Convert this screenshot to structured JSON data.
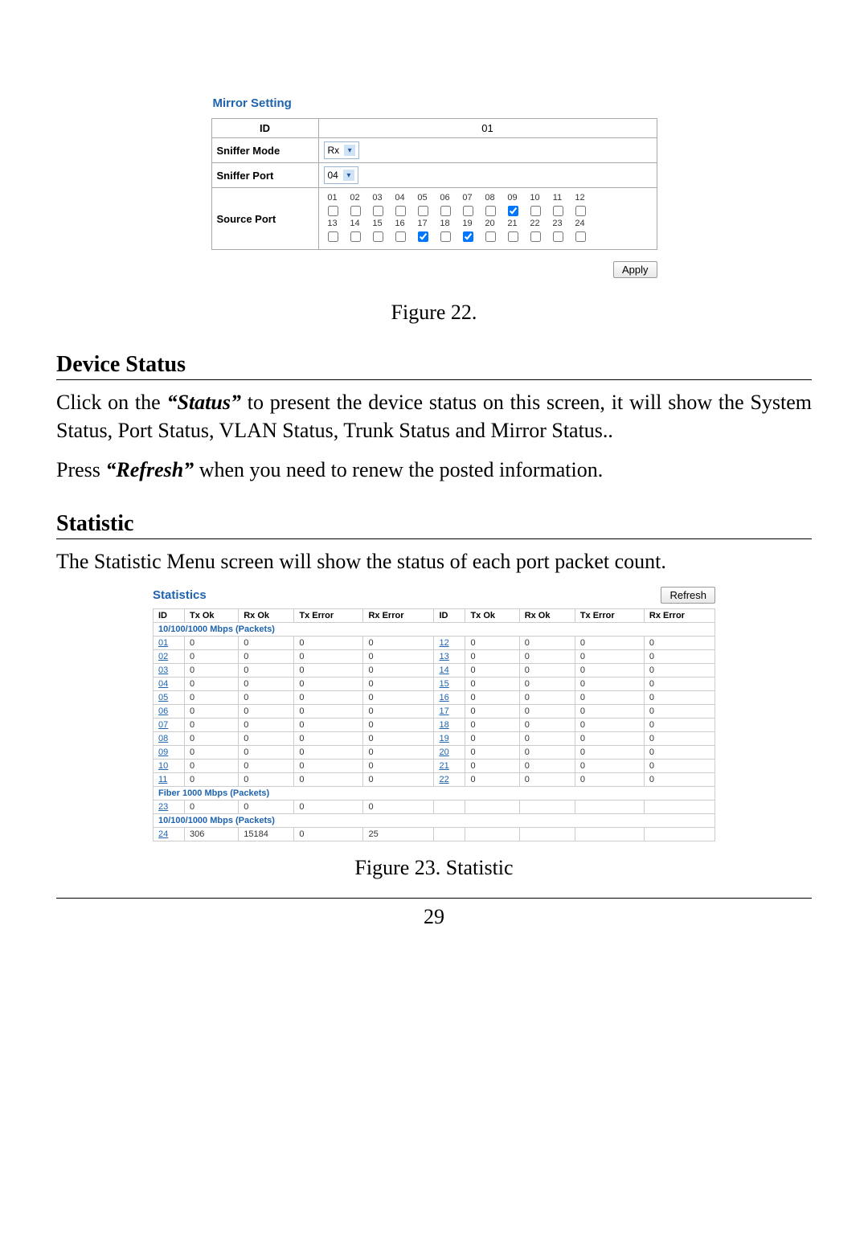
{
  "figure22": {
    "title": "Mirror Setting",
    "rows": {
      "id_label": "ID",
      "id_value": "01",
      "mode_label": "Sniffer Mode",
      "mode_value": "Rx",
      "port_label": "Sniffer Port",
      "port_value": "04",
      "source_label": "Source Port"
    },
    "port_numbers_top": [
      "01",
      "02",
      "03",
      "04",
      "05",
      "06",
      "07",
      "08",
      "09",
      "10",
      "11",
      "12"
    ],
    "port_numbers_bottom": [
      "13",
      "14",
      "15",
      "16",
      "17",
      "18",
      "19",
      "20",
      "21",
      "22",
      "23",
      "24"
    ],
    "checked_ports_top_idx": [
      8
    ],
    "checked_ports_bottom_idx": [
      4,
      6
    ],
    "apply_label": "Apply",
    "caption": "Figure 22."
  },
  "section1": {
    "heading": "Device Status",
    "p1a": "Click on the ",
    "p1_em": "“Status”",
    "p1b": " to present the device status on this screen, it will show the System Status, Port Status, VLAN Status, Trunk Status and Mirror Status..",
    "p2a": "Press ",
    "p2_em": "“Refresh”",
    "p2b": " when you need to renew the posted information."
  },
  "section2": {
    "heading": "Statistic",
    "p1": "The Statistic Menu screen will show the status of each port packet count."
  },
  "figure23": {
    "title": "Statistics",
    "refresh_label": "Refresh",
    "headers": [
      "ID",
      "Tx Ok",
      "Rx Ok",
      "Tx Error",
      "Rx Error",
      "ID",
      "Tx Ok",
      "Rx Ok",
      "Tx Error",
      "Rx Error"
    ],
    "section_a": "10/100/1000 Mbps (Packets)",
    "section_b": "Fiber 1000 Mbps (Packets)",
    "section_c": "10/100/1000 Mbps (Packets)",
    "left_rows": [
      {
        "id": "01",
        "tx": "0",
        "rx": "0",
        "txe": "0",
        "rxe": "0"
      },
      {
        "id": "02",
        "tx": "0",
        "rx": "0",
        "txe": "0",
        "rxe": "0"
      },
      {
        "id": "03",
        "tx": "0",
        "rx": "0",
        "txe": "0",
        "rxe": "0"
      },
      {
        "id": "04",
        "tx": "0",
        "rx": "0",
        "txe": "0",
        "rxe": "0"
      },
      {
        "id": "05",
        "tx": "0",
        "rx": "0",
        "txe": "0",
        "rxe": "0"
      },
      {
        "id": "06",
        "tx": "0",
        "rx": "0",
        "txe": "0",
        "rxe": "0"
      },
      {
        "id": "07",
        "tx": "0",
        "rx": "0",
        "txe": "0",
        "rxe": "0"
      },
      {
        "id": "08",
        "tx": "0",
        "rx": "0",
        "txe": "0",
        "rxe": "0"
      },
      {
        "id": "09",
        "tx": "0",
        "rx": "0",
        "txe": "0",
        "rxe": "0"
      },
      {
        "id": "10",
        "tx": "0",
        "rx": "0",
        "txe": "0",
        "rxe": "0"
      },
      {
        "id": "11",
        "tx": "0",
        "rx": "0",
        "txe": "0",
        "rxe": "0"
      }
    ],
    "right_rows": [
      {
        "id": "12",
        "tx": "0",
        "rx": "0",
        "txe": "0",
        "rxe": "0"
      },
      {
        "id": "13",
        "tx": "0",
        "rx": "0",
        "txe": "0",
        "rxe": "0"
      },
      {
        "id": "14",
        "tx": "0",
        "rx": "0",
        "txe": "0",
        "rxe": "0"
      },
      {
        "id": "15",
        "tx": "0",
        "rx": "0",
        "txe": "0",
        "rxe": "0"
      },
      {
        "id": "16",
        "tx": "0",
        "rx": "0",
        "txe": "0",
        "rxe": "0"
      },
      {
        "id": "17",
        "tx": "0",
        "rx": "0",
        "txe": "0",
        "rxe": "0"
      },
      {
        "id": "18",
        "tx": "0",
        "rx": "0",
        "txe": "0",
        "rxe": "0"
      },
      {
        "id": "19",
        "tx": "0",
        "rx": "0",
        "txe": "0",
        "rxe": "0"
      },
      {
        "id": "20",
        "tx": "0",
        "rx": "0",
        "txe": "0",
        "rxe": "0"
      },
      {
        "id": "21",
        "tx": "0",
        "rx": "0",
        "txe": "0",
        "rxe": "0"
      },
      {
        "id": "22",
        "tx": "0",
        "rx": "0",
        "txe": "0",
        "rxe": "0"
      }
    ],
    "fiber_row": {
      "id": "23",
      "tx": "0",
      "rx": "0",
      "txe": "0",
      "rxe": "0"
    },
    "final_row": {
      "id": "24",
      "tx": "306",
      "rx": "15184",
      "txe": "0",
      "rxe": "25"
    },
    "caption": "Figure 23. Statistic"
  },
  "page_number": "29"
}
